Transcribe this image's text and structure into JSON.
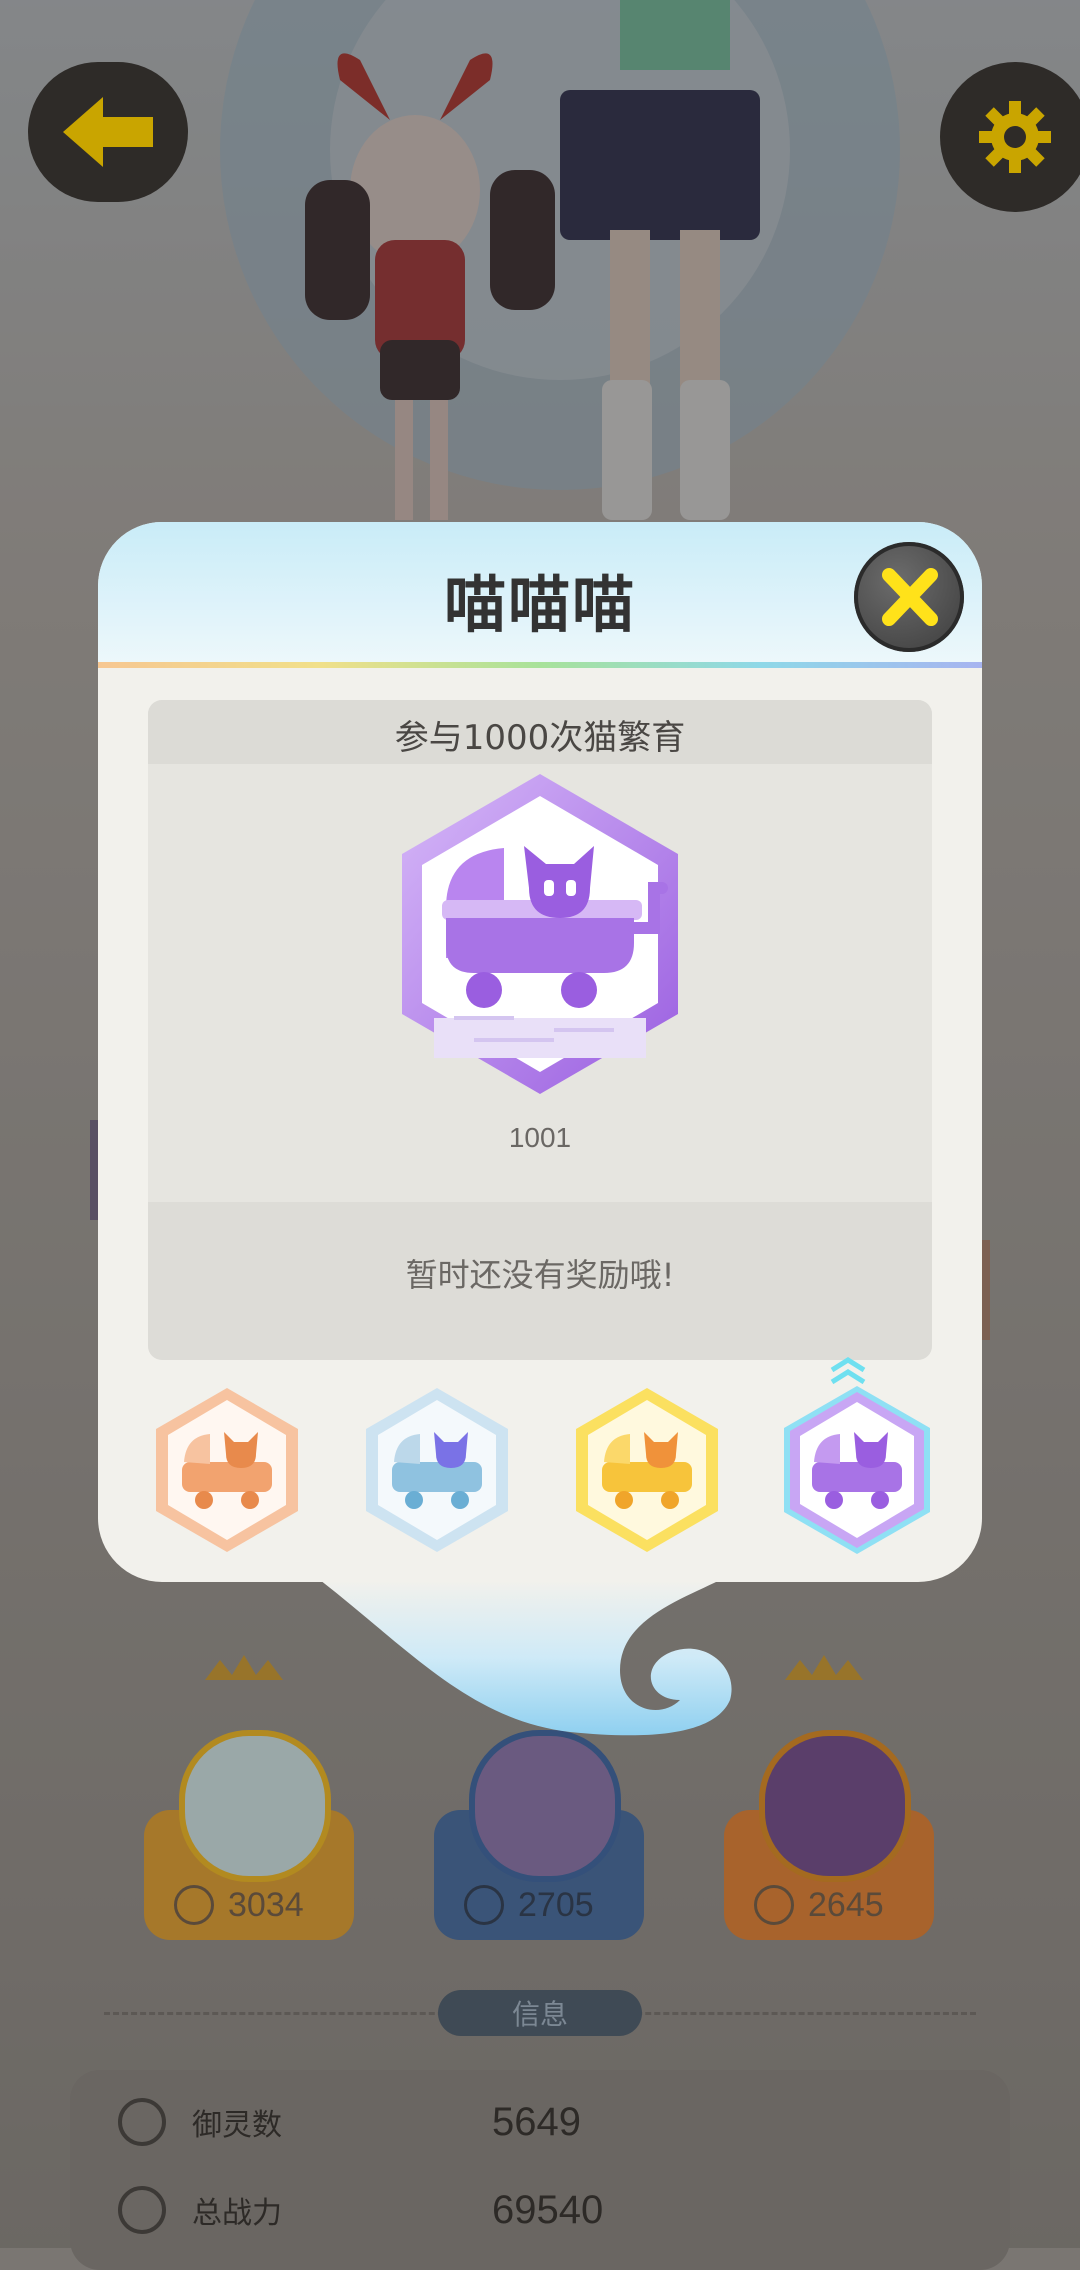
{
  "window": {
    "width": 1080,
    "height": 2248
  },
  "nav": {
    "back_icon": "arrow-left-icon",
    "settings_icon": "gear-icon"
  },
  "dialog": {
    "title": "喵喵喵",
    "close_icon": "close-x-icon",
    "achievement": {
      "requirement": "参与1000次猫繁育",
      "badge_icon": "cat-stroller-icon",
      "code": "1001",
      "reward_text": "暂时还没有奖励哦!"
    },
    "tiers": [
      {
        "name": "bronze",
        "color": "#f2a36f",
        "selected": false
      },
      {
        "name": "silver",
        "color": "#8fc2e0",
        "selected": false
      },
      {
        "name": "gold",
        "color": "#f7c43b",
        "selected": false
      },
      {
        "name": "purple",
        "color": "#a873e6",
        "selected": true
      }
    ]
  },
  "heroes": [
    {
      "score": "3034",
      "card_color": "#b98a2e",
      "crown": true
    },
    {
      "score": "2705",
      "card_color": "#3b5a86",
      "crown": false
    },
    {
      "score": "2645",
      "card_color": "#b0672e",
      "crown": true
    }
  ],
  "info": {
    "tag": "信息",
    "stats": [
      {
        "label": "御灵数",
        "value": "5649",
        "icon": "spirit-icon"
      },
      {
        "label": "总战力",
        "value": "69540",
        "icon": "power-icon"
      }
    ]
  },
  "colors": {
    "accent_yellow": "#ffe21a",
    "dialog_bg": "#f2f1ec",
    "badge_purple": "#a873e6"
  }
}
